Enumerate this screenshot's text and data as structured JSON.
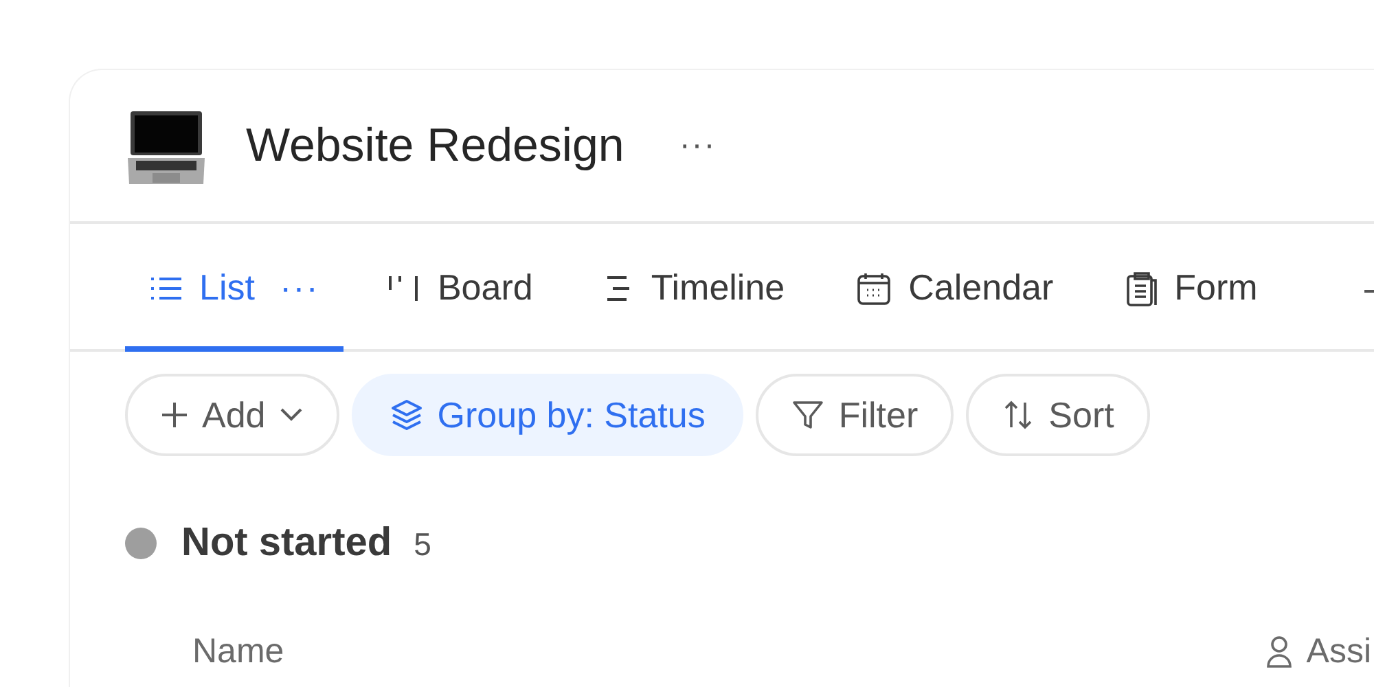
{
  "project": {
    "title": "Website Redesign",
    "more": "···"
  },
  "tabs": [
    {
      "kind": "list",
      "label": "List",
      "selected": true,
      "more": "···"
    },
    {
      "kind": "board",
      "label": "Board",
      "selected": false
    },
    {
      "kind": "timeline",
      "label": "Timeline",
      "selected": false
    },
    {
      "kind": "calendar",
      "label": "Calendar",
      "selected": false
    },
    {
      "kind": "form",
      "label": "Form",
      "selected": false
    }
  ],
  "toolbar": [
    {
      "kind": "add",
      "label": "Add",
      "selected": false
    },
    {
      "kind": "group",
      "label": "Group by: Status",
      "selected": true
    },
    {
      "kind": "filter",
      "label": "Filter",
      "selected": false
    },
    {
      "kind": "sort",
      "label": "Sort",
      "selected": false
    }
  ],
  "group": {
    "label": "Not started",
    "count": "5",
    "color": "#9e9e9e"
  },
  "table": {
    "columns": [
      {
        "label": "Name"
      },
      {
        "label": "Assi",
        "kind": "assignee"
      }
    ]
  }
}
